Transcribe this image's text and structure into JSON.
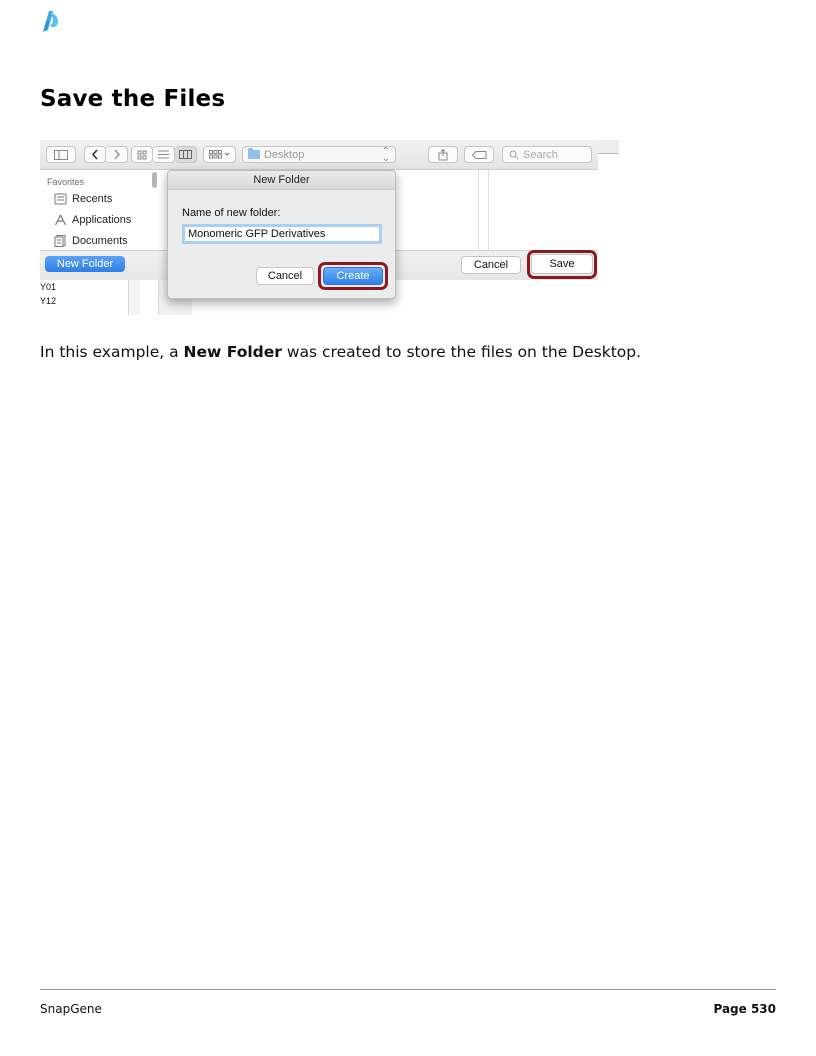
{
  "page": {
    "title": "Save the Files",
    "body_before": "In this example, a ",
    "body_bold": "New Folder",
    "body_after": " was created to store the files on the Desktop.",
    "footer_left": "SnapGene",
    "footer_page_label": "Page 530"
  },
  "screenshot": {
    "toolbar": {
      "location": "Desktop",
      "search_placeholder": "Search"
    },
    "sidebar": {
      "heading": "Favorites",
      "items": [
        {
          "label": "Recents",
          "icon": "recents-icon"
        },
        {
          "label": "Applications",
          "icon": "applications-icon"
        },
        {
          "label": "Documents",
          "icon": "documents-icon"
        }
      ]
    },
    "new_folder_button": "New Folder",
    "cancel_button": "Cancel",
    "save_button": "Save",
    "background_list": [
      "Y01",
      "Y12"
    ],
    "dialog": {
      "title": "New Folder",
      "label": "Name of new folder:",
      "input_value": "Monomeric GFP Derivatives",
      "cancel_label": "Cancel",
      "create_label": "Create"
    }
  },
  "colors": {
    "accent_blue": "#3b8bef",
    "highlight_ring": "#8a1a20",
    "logo_blue": "#3aa8e8"
  }
}
